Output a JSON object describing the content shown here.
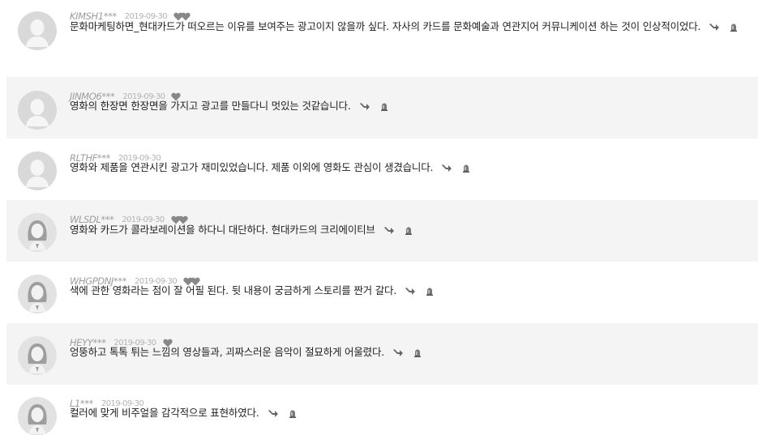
{
  "comments": [
    {
      "user": "KIMSH1***",
      "date": "2019-09-30",
      "likes": 2,
      "avatar": "male",
      "text": "문화마케팅하면_현대카드가 떠오르는 이유를 보여주는 광고이지 않을까 싶다. 자사의 카드를 문화예술과 연관지어 커뮤니케이션 하는 것이 인상적이었다."
    },
    {
      "user": "JINMO6***",
      "date": "2019-09-30",
      "likes": 1,
      "avatar": "male",
      "text": "영화의 한장면 한장면을 가지고 광고를 만들다니 멋있는 것같습니다."
    },
    {
      "user": "RLTHF***",
      "date": "2019-09-30",
      "likes": 0,
      "avatar": "male",
      "text": "영화와 제품을 연관시킨 광고가 재미있었습니다. 제품 이외에 영화도 관심이 생겼습니다."
    },
    {
      "user": "WLSDL***",
      "date": "2019-09-30",
      "likes": 2,
      "avatar": "female",
      "text": "영화와 카드가 콜라보레이션을 하다니 대단하다. 현대카드의 크리에이티브"
    },
    {
      "user": "WHGPDNJ***",
      "date": "2019-09-30",
      "likes": 2,
      "avatar": "female",
      "text": "색에 관한 영화라는 점이 잘 어필 된다. 뒷 내용이 궁금하게 스토리를 짠거 갈다."
    },
    {
      "user": "HEYY***",
      "date": "2019-09-30",
      "likes": 1,
      "avatar": "female",
      "text": "엉뚱하고 톡톡 튀는 느낌의 영상들과, 괴짜스러운 음악이 절묘하게 어울렸다."
    },
    {
      "user": "L1***",
      "date": "2019-09-30",
      "likes": 0,
      "avatar": "female",
      "text": "컬러에 맞게 비주얼을 감각적으로 표현하였다."
    }
  ],
  "colors": {
    "shade": "#f4f4f4",
    "heart": "#888888",
    "meta": "#9c9c9c"
  },
  "icons": {
    "reply": "reply-arrow-icon",
    "report": "report-siren-icon",
    "like": "heart-icon"
  }
}
